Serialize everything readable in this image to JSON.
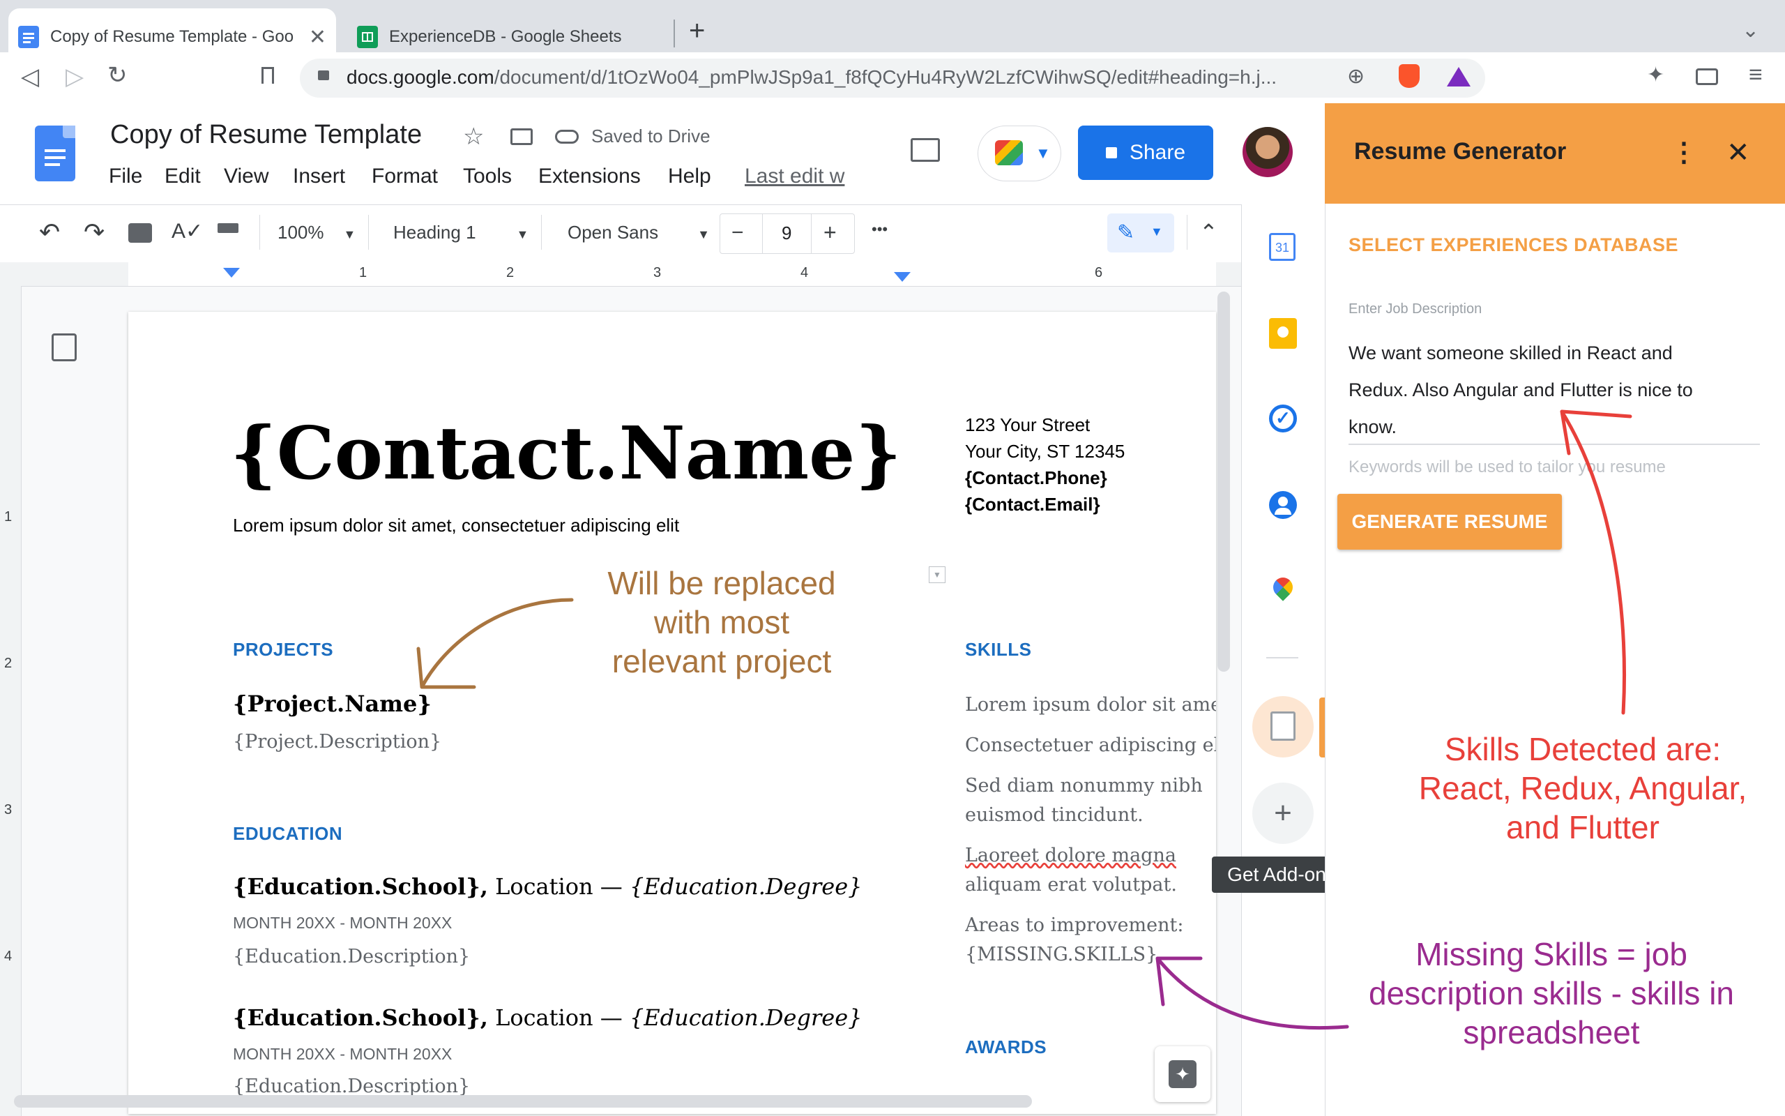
{
  "browser": {
    "tabs": [
      {
        "title": "Copy of Resume Template - Goo",
        "active": true,
        "favicon_color": "#4285f4"
      },
      {
        "title": "ExperienceDB - Google Sheets",
        "active": false,
        "favicon_color": "#0f9d58"
      }
    ],
    "new_tab_glyph": "+",
    "url_domain": "docs.google.com",
    "url_path": "/document/d/1tOzWo04_pmPlwJSp9a1_f8fQCyHu4RyW2LzfCWihwSQ/edit#heading=h.j..."
  },
  "docs": {
    "title": "Copy of Resume Template",
    "saved_status": "Saved to Drive",
    "menu": [
      "File",
      "Edit",
      "View",
      "Insert",
      "Format",
      "Tools",
      "Extensions",
      "Help"
    ],
    "last_edit": "Last edit w",
    "share_label": "Share",
    "toolbar": {
      "zoom": "100%",
      "style": "Heading 1",
      "font": "Open Sans",
      "font_size": "9",
      "minus": "−",
      "plus": "+",
      "more": "•••"
    },
    "ruler_numbers": [
      "1",
      "2",
      "3",
      "4",
      "6"
    ],
    "vruler_numbers": [
      "1",
      "2",
      "3",
      "4"
    ]
  },
  "resume": {
    "name": "{Contact.Name}",
    "tagline": "Lorem ipsum dolor sit amet, consectetuer adipiscing elit",
    "address": [
      "123 Your Street",
      "Your City, ST 12345"
    ],
    "phone": "{Contact.Phone}",
    "email": "{Contact.Email}",
    "projects_heading": "PROJECTS",
    "project_name": "{Project.Name}",
    "project_desc": "{Project.Description}",
    "education_heading": "EDUCATION",
    "education": [
      {
        "school": "{Education.School},",
        "location": " Location — ",
        "degree": "{Education.Degree}",
        "dates": "MONTH 20XX - MONTH 20XX",
        "desc": "{Education.Description}"
      },
      {
        "school": "{Education.School},",
        "location": " Location — ",
        "degree": "{Education.Degree}",
        "dates": "MONTH 20XX - MONTH 20XX",
        "desc": "{Education.Description}"
      }
    ],
    "skills_heading": "SKILLS",
    "skills": [
      "Lorem ipsum dolor sit amet",
      "Consectetuer adipiscing elit",
      "Sed diam nonummy nibh",
      "euismod tincidunt.",
      "Laoreet dolore magna",
      "aliquam erat volutpat.",
      "Areas to improvement:",
      "{MISSING.SKILLS}"
    ],
    "awards_heading": "AWARDS"
  },
  "tooltip": "Get Add-ons",
  "panel": {
    "title": "Resume Generator",
    "section_title": "SELECT EXPERIENCES DATABASE",
    "field_label": "Enter Job Description",
    "field_value_lines": [
      "We want someone skilled in React and",
      "Redux. Also Angular and Flutter is nice to",
      "know."
    ],
    "helper_text": "Keywords will be used to tailor you resume",
    "generate_button": "GENERATE RESUME"
  },
  "annotations": {
    "brown": [
      "Will be replaced",
      "with most",
      "relevant project"
    ],
    "red": [
      "Skills Detected are:",
      "React, Redux, Angular,",
      "and Flutter"
    ],
    "purple": [
      "Missing Skills = job",
      "description skills - skills in",
      "spreadsheet"
    ]
  },
  "colors": {
    "panel_orange": "#f49f45",
    "share_blue": "#1a73e8",
    "heading_blue": "#1c6dbf",
    "annot_red": "#e8403a",
    "annot_purple": "#9a2b8f",
    "annot_brown": "#a9753f"
  }
}
